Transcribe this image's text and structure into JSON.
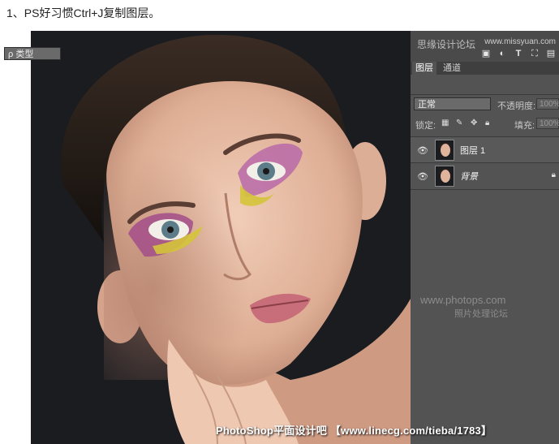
{
  "caption": "1、PS好习惯Ctrl+J复制图层。",
  "panel": {
    "site_name": "思缘设计论坛",
    "site_url": "www.missyuan.com",
    "tabs": [
      {
        "label": "图层",
        "active": true
      },
      {
        "label": "通道",
        "active": false
      }
    ],
    "filter": {
      "label": "ρ 类型"
    },
    "filter_icons": [
      "image-filter-icon",
      "adjustment-filter-icon",
      "type-filter-icon",
      "shape-filter-icon",
      "smart-object-filter-icon"
    ],
    "blend_mode": "正常",
    "opacity_label": "不透明度:",
    "opacity_value": "100%",
    "lock_label": "锁定:",
    "fill_label": "填充:",
    "fill_value": "100%",
    "layers": [
      {
        "name": "图层 1",
        "visible": true,
        "locked": false
      },
      {
        "name": "背景",
        "visible": true,
        "locked": true
      }
    ]
  },
  "watermark": {
    "line1": "www.photops.com",
    "line2": "照片处理论坛"
  },
  "credit": "PhotoShop平面设计吧 【www.linecg.com/tieba/1783】"
}
